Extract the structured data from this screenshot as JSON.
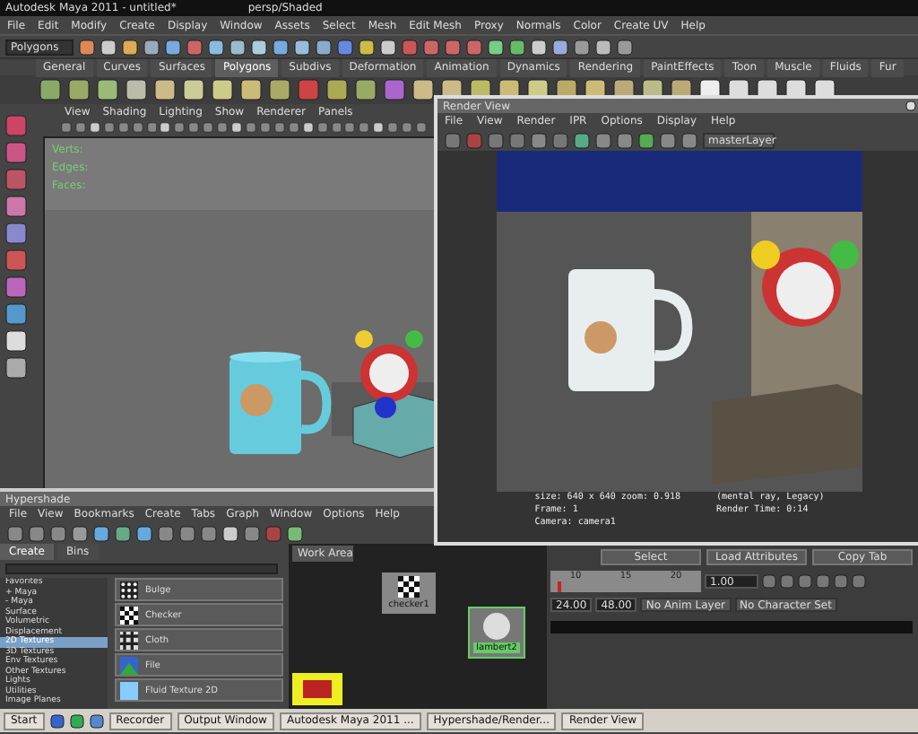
{
  "window": {
    "title": "Autodesk Maya 2011 - untitled*",
    "subtitle": "persp/Shaded"
  },
  "menu": [
    "File",
    "Edit",
    "Modify",
    "Create",
    "Display",
    "Window",
    "Assets",
    "Select",
    "Mesh",
    "Edit Mesh",
    "Proxy",
    "Normals",
    "Color",
    "Create UV",
    "Help"
  ],
  "status_line": {
    "menu_set": "Polygons"
  },
  "shelf": {
    "tabs": [
      {
        "label": "General",
        "selected": false
      },
      {
        "label": "Curves",
        "selected": false
      },
      {
        "label": "Surfaces",
        "selected": false
      },
      {
        "label": "Polygons",
        "selected": true
      },
      {
        "label": "Subdivs",
        "selected": false
      },
      {
        "label": "Deformation",
        "selected": false
      },
      {
        "label": "Animation",
        "selected": false
      },
      {
        "label": "Dynamics",
        "selected": false
      },
      {
        "label": "Rendering",
        "selected": false
      },
      {
        "label": "PaintEffects",
        "selected": false
      },
      {
        "label": "Toon",
        "selected": false
      },
      {
        "label": "Muscle",
        "selected": false
      },
      {
        "label": "Fluids",
        "selected": false
      },
      {
        "label": "Fur",
        "selected": false
      }
    ]
  },
  "viewport": {
    "menu": [
      "View",
      "Shading",
      "Lighting",
      "Show",
      "Renderer",
      "Panels"
    ],
    "hud": [
      "Verts:",
      "Edges:",
      "Faces:"
    ]
  },
  "render_view": {
    "title": "Render View",
    "menu": [
      "File",
      "View",
      "Render",
      "IPR",
      "Options",
      "Display",
      "Help"
    ],
    "layer": "masterLayer",
    "info": [
      "size: 640 x 640  zoom: 0.918",
      "(mental ray, Legacy)",
      "Frame: 1",
      "Render Time: 0:14",
      "Camera: camera1"
    ]
  },
  "hypershade": {
    "title": "Hypershade",
    "menu": [
      "File",
      "View",
      "Bookmarks",
      "Create",
      "Tabs",
      "Graph",
      "Window",
      "Options",
      "Help"
    ],
    "tabs": [
      {
        "label": "Create",
        "selected": true
      },
      {
        "label": "Bins",
        "selected": false
      }
    ],
    "tree": [
      {
        "label": "Favorites",
        "selected": false
      },
      {
        "label": "+ Maya",
        "selected": false
      },
      {
        "label": "- Maya",
        "selected": false
      },
      {
        "label": "Surface",
        "selected": false
      },
      {
        "label": "Volumetric",
        "selected": false
      },
      {
        "label": "Displacement",
        "selected": false
      },
      {
        "label": "2D Textures",
        "selected": true
      },
      {
        "label": "3D Textures",
        "selected": false
      },
      {
        "label": "Env Textures",
        "selected": false
      },
      {
        "label": "Other Textures",
        "selected": false
      },
      {
        "label": "Lights",
        "selected": false
      },
      {
        "label": "Utilities",
        "selected": false
      },
      {
        "label": "Image Planes",
        "selected": false
      }
    ],
    "swatches": [
      {
        "label": "Bulge",
        "kind": "grid"
      },
      {
        "label": "Checker",
        "kind": "checker"
      },
      {
        "label": "Cloth",
        "kind": "cloth"
      },
      {
        "label": "File",
        "kind": "mountain"
      },
      {
        "label": "Fluid Texture 2D",
        "kind": "sky"
      }
    ],
    "work_tab": "Work Area",
    "nodes": [
      "checker1",
      "lambert2"
    ]
  },
  "time": {
    "level": 0.05,
    "buttons": [
      "Select",
      "Load Attributes",
      "Copy Tab"
    ],
    "ticks": [
      "10",
      "15",
      "20"
    ],
    "current": "1.00",
    "range": [
      "24.00",
      "48.00"
    ],
    "anim_layer": "No Anim Layer",
    "character_set": "No Character Set"
  },
  "taskbar": [
    "Start",
    "Recorder",
    "Output Window",
    "Autodesk Maya 2011 ...",
    "Hypershade/Render...",
    "Render View"
  ]
}
